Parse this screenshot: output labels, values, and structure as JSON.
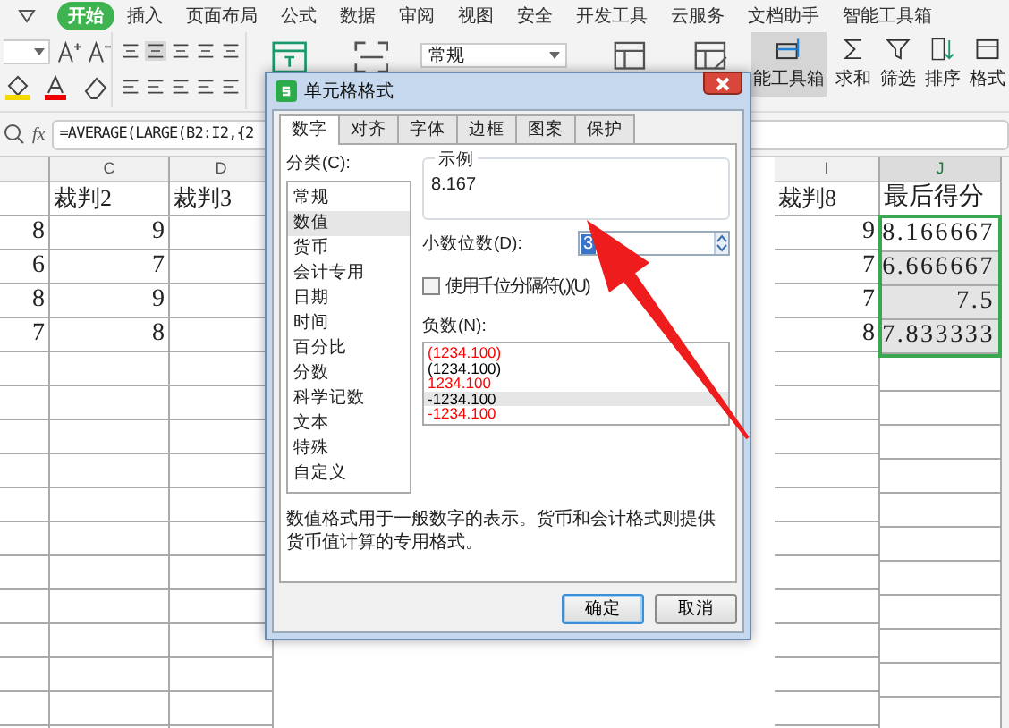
{
  "menu": {
    "tabs": [
      {
        "label": "开始",
        "selected": true
      },
      {
        "label": "插入",
        "selected": false
      },
      {
        "label": "页面布局",
        "selected": false
      },
      {
        "label": "公式",
        "selected": false
      },
      {
        "label": "数据",
        "selected": false
      },
      {
        "label": "审阅",
        "selected": false
      },
      {
        "label": "视图",
        "selected": false
      },
      {
        "label": "安全",
        "selected": false
      },
      {
        "label": "开发工具",
        "selected": false
      },
      {
        "label": "云服务",
        "selected": false
      },
      {
        "label": "文档助手",
        "selected": false
      },
      {
        "label": "智能工具箱",
        "selected": false
      }
    ]
  },
  "ribbon": {
    "number_format": "常规",
    "tools": [
      {
        "label": "能工具箱",
        "kind": "toolbox",
        "highlighted": true
      },
      {
        "label": "求和",
        "kind": "sum",
        "highlighted": false
      },
      {
        "label": "筛选",
        "kind": "filter",
        "highlighted": false
      },
      {
        "label": "排序",
        "kind": "sort",
        "highlighted": false
      },
      {
        "label": "格式",
        "kind": "format",
        "highlighted": false
      }
    ]
  },
  "formula_bar": {
    "function_label": "fx",
    "formula": "=AVERAGE(LARGE(B2:I2,{2"
  },
  "sheet": {
    "columns": [
      {
        "cells": [
          "8",
          "6",
          "8",
          "7"
        ],
        "selected": false
      },
      {
        "header": "C",
        "title": "裁判2",
        "cells": [
          "9",
          "7",
          "9",
          "8"
        ],
        "selected": false
      },
      {
        "header": "D",
        "title": "裁判3",
        "selected": false
      },
      {
        "header": "I",
        "title": "裁判8",
        "cells": [
          "9",
          "7",
          "7",
          "8"
        ],
        "selected": false
      },
      {
        "header": "J",
        "title": "最后得分",
        "cells": [
          "8.166667",
          "6.666667",
          "7.5",
          "7.833333"
        ],
        "selected": true
      }
    ]
  },
  "dialog": {
    "title": "单元格格式",
    "tabs": [
      {
        "label": "数字",
        "selected": true
      },
      {
        "label": "对齐",
        "selected": false
      },
      {
        "label": "字体",
        "selected": false
      },
      {
        "label": "边框",
        "selected": false
      },
      {
        "label": "图案",
        "selected": false
      },
      {
        "label": "保护",
        "selected": false
      }
    ],
    "category_label": "分类(C):",
    "categories": [
      {
        "label": "常规",
        "selected": false
      },
      {
        "label": "数值",
        "selected": true
      },
      {
        "label": "货币",
        "selected": false
      },
      {
        "label": "会计专用",
        "selected": false
      },
      {
        "label": "日期",
        "selected": false
      },
      {
        "label": "时间",
        "selected": false
      },
      {
        "label": "百分比",
        "selected": false
      },
      {
        "label": "分数",
        "selected": false
      },
      {
        "label": "科学记数",
        "selected": false
      },
      {
        "label": "文本",
        "selected": false
      },
      {
        "label": "特殊",
        "selected": false
      },
      {
        "label": "自定义",
        "selected": false
      }
    ],
    "sample": {
      "label": "示例",
      "value": "8.167"
    },
    "decimals": {
      "label": "小数位数(D):",
      "value": "3"
    },
    "thousands": {
      "label": "使用千位分隔符(,)(U)",
      "checked": false
    },
    "negatives_label": "负数(N):",
    "negatives": [
      {
        "label": "(1234.100)",
        "color": "#ff0000",
        "selected": false
      },
      {
        "label": "(1234.100)",
        "color": "#000000",
        "selected": false
      },
      {
        "label": "1234.100",
        "color": "#ff0000",
        "selected": false
      },
      {
        "label": "-1234.100",
        "color": "#000000",
        "selected": true
      },
      {
        "label": "-1234.100",
        "color": "#ff0000",
        "selected": false
      }
    ],
    "description": "数值格式用于一般数字的表示。货币和会计格式则提供货币值计算的专用格式。",
    "buttons": [
      {
        "label": "确定",
        "default": true
      },
      {
        "label": "取消",
        "default": false
      }
    ]
  }
}
